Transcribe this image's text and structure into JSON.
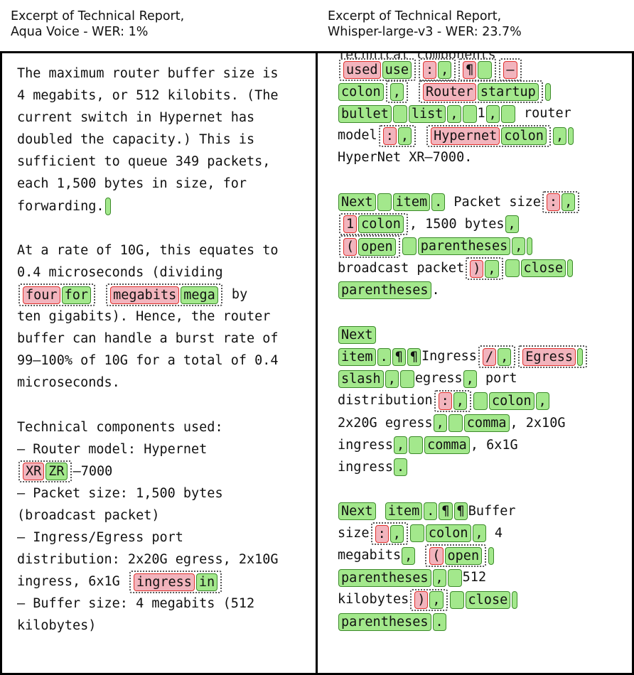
{
  "left": {
    "title_line1": "Excerpt of Technical Report,",
    "title_line2": "Aqua Voice - WER: 1%",
    "p1": [
      "The maximum router buffer size is",
      "4 megabits, or 512 kilobits. (The",
      "current switch in Hypernet has",
      "doubled the capacity.) This is",
      "sufficient to queue 349 packets,",
      "each 1,500 bytes in size, for"
    ],
    "p1_last": "forwarding.",
    "p2": [
      "At a rate of 10G, this equates to",
      "0.4 microseconds (dividing"
    ],
    "p2_err1": {
      "wrong": "four",
      "right": "for"
    },
    "p2_err2": {
      "wrong": "megabits",
      "right": "mega"
    },
    "p2_after": " by",
    "p2_rest": [
      "ten gigabits). Hence, the router",
      "buffer can handle a burst rate of",
      "99–100% of 10G for a total of 0.4",
      "microseconds."
    ],
    "p3_1": "Technical components used:",
    "p3_2": "– Router model: Hypernet",
    "p3_err": {
      "wrong": "XR",
      "right": "ZR"
    },
    "p3_3_after": "–7000",
    "p3_4": "– Packet size: 1,500 bytes",
    "p3_5": "(broadcast packet)",
    "p3_6": "– Ingress/Egress port",
    "p3_7": "distribution: 2x20G egress, 2x10G",
    "p3_8_before": "ingress, 6x1G ",
    "p3_err2": {
      "wrong": "ingress",
      "right": "in"
    },
    "p3_9": "– Buffer size: 4 megabits (512",
    "p3_10": "kilobytes)"
  },
  "right": {
    "title_line1": "Excerpt of Technical Report,",
    "title_line2": "Whisper-large-v3 - WER: 23.7%",
    "cut_line": "Technical components",
    "t": {
      "used": "used",
      "use": "use",
      "colon_sym": ":",
      "comma": ",",
      "pilcrow": "¶",
      "dash": "–",
      "colon_word": "colon",
      "Router": "Router",
      "startup": "startup",
      "bullet": "bullet",
      "list": "list",
      "one": "1",
      "router": " router",
      "model": "model",
      "Hypernet": "Hypernet",
      "hypernet_line": "HyperNet XR–7000.",
      "Next": "Next",
      "item": "item",
      "period": ".",
      "packet_size": " Packet size",
      "one_err": "1",
      "bytes": ", 1500 bytes",
      "open_sym": "(",
      "open": "open",
      "parentheses": "parentheses",
      "broadcast": "broadcast packet",
      "close_sym": ")",
      "close": "close",
      "ingress_w": "Ingress",
      "slash_sym": "/",
      "Egress": "Egress",
      "slash": "slash",
      "egress": "egress",
      "port": " port",
      "distribution": "distribution",
      "egress_2x20": "2x20G egress",
      "comma_word": "comma",
      "x10": ", 2x10G",
      "ingress": "ingress",
      "x1": ", 6x1G",
      "buffer": "Buffer",
      "size": "size",
      "four": " 4",
      "megabits": "megabits",
      "five12": "512",
      "kilobytes": "kilobytes",
      "one_comma": "1,"
    }
  }
}
